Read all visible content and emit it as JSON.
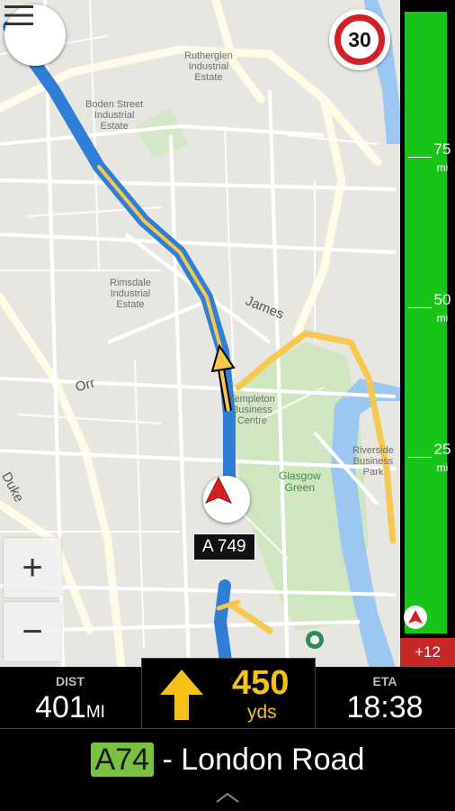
{
  "map": {
    "labels": {
      "rutherglen": "Rutherglen\nIndustrial\nEstate",
      "boden": "Boden Street\nIndustrial\nEstate",
      "rimsdale": "Rimsdale\nIndustrial\nEstate",
      "james": "James",
      "orr": "Orr",
      "templeton": "Templeton\nBusiness\nCentre",
      "glasgow_green": "Glasgow\nGreen",
      "riverside": "Riverside\nBusiness\nPark",
      "duke": "Duke"
    },
    "current_road": "A 749",
    "zoom_in": "+",
    "zoom_out": "−"
  },
  "speed_limit": "30",
  "trip_bar": {
    "ticks": [
      {
        "value": "75",
        "unit": "mi"
      },
      {
        "value": "50",
        "unit": "mi"
      },
      {
        "value": "25",
        "unit": "mi"
      }
    ],
    "delay": "+12",
    "colors": {
      "route": "#17c417",
      "delay": "#c62828"
    }
  },
  "nav": {
    "dist_label": "DIST",
    "dist_value": "401",
    "dist_unit": "MI",
    "maneuver_distance": "450",
    "maneuver_unit": "yds",
    "eta_label": "ETA",
    "eta_value": "18:38",
    "road_badge": "A74",
    "street_name": "- London Road"
  },
  "icons": [
    "menu-icon",
    "turn-arrow-icon",
    "position-arrow-icon",
    "chevron-up-icon",
    "football-icon"
  ]
}
